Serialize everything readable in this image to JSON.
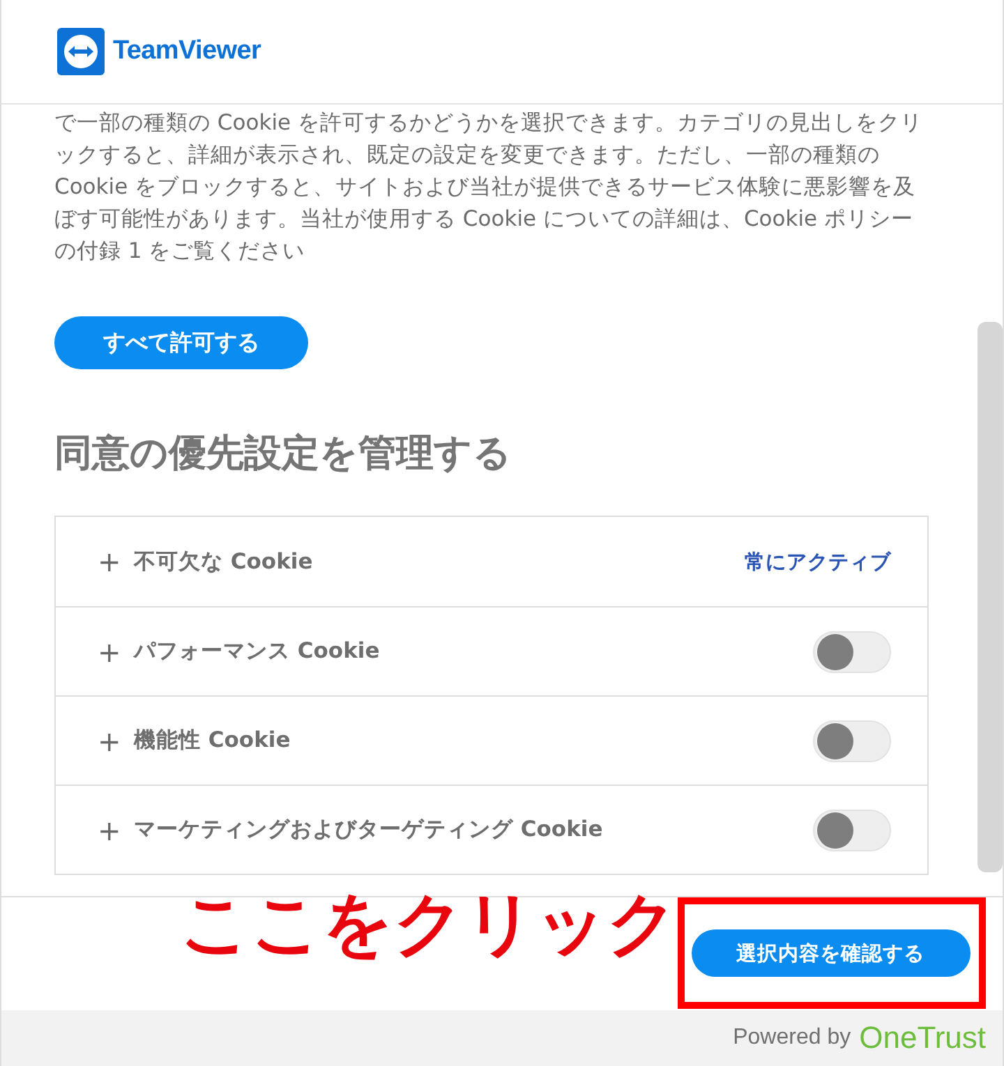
{
  "header": {
    "logo_text": "TeamViewer"
  },
  "intro": "で一部の種類の Cookie を許可するかどうかを選択できます。カテゴリの見出しをクリックすると、詳細が表示され、既定の設定を変更できます。ただし、一部の種類の Cookie をブロックすると、サイトおよび当社が提供できるサービス体験に悪影響を及ぼす可能性があります。当社が使用する Cookie についての詳細は、Cookie ポリシーの付録 1 をご覧ください",
  "allow_all_button": "すべて許可する",
  "heading": "同意の優先設定を管理する",
  "categories": [
    {
      "kind": "always_active",
      "expander": "+",
      "label": "不可欠な Cookie",
      "status": "常にアクティブ"
    },
    {
      "kind": "toggle",
      "expander": "+",
      "label": "パフォーマンス Cookie",
      "on": false
    },
    {
      "kind": "toggle",
      "expander": "+",
      "label": "機能性 Cookie",
      "on": false
    },
    {
      "kind": "toggle",
      "expander": "+",
      "label": "マーケティングおよびターゲティング Cookie",
      "on": false
    }
  ],
  "annotation": "ここをクリック",
  "confirm_button": "選択内容を確認する",
  "footer": {
    "powered_by": "Powered by",
    "brand": "OneTrust"
  }
}
